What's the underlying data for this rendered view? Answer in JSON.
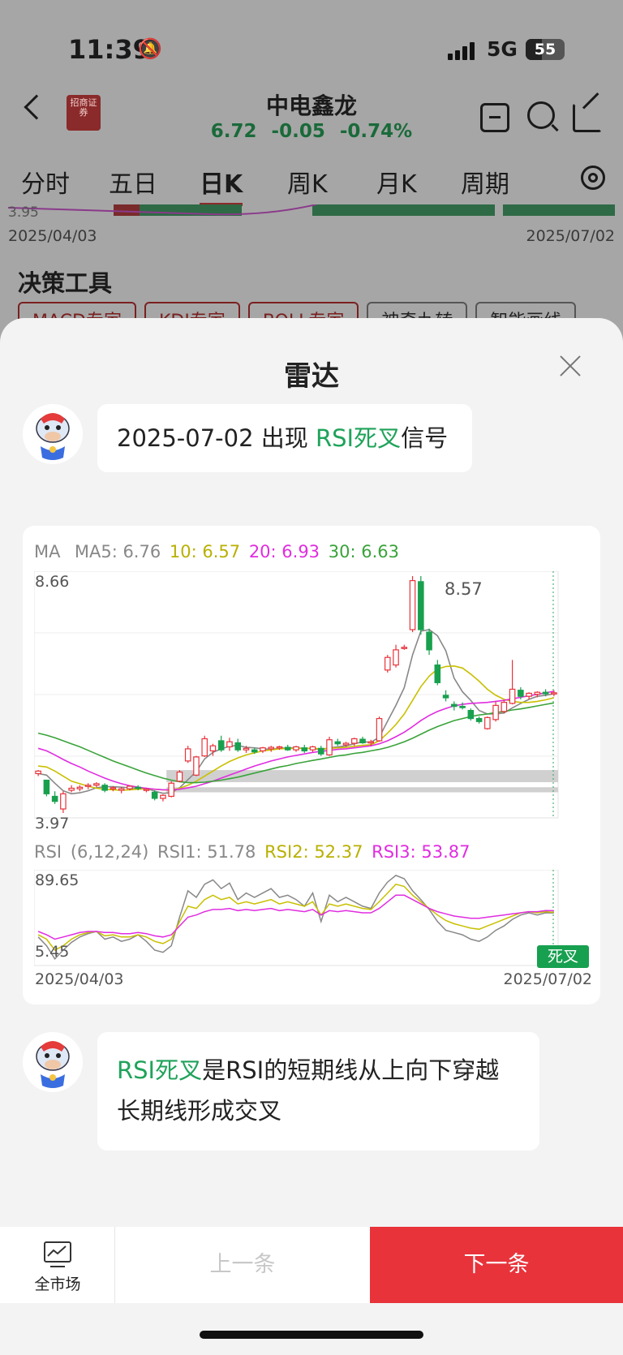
{
  "status_bar": {
    "time": "11:39",
    "network": "5G",
    "battery": "55"
  },
  "header": {
    "broker_logo": "招商证券",
    "stock_name": "中电鑫龙",
    "price": "6.72",
    "change": "-0.05",
    "change_pct": "-0.74%"
  },
  "tabs": [
    "分时",
    "五日",
    "日K",
    "周K",
    "月K",
    "周期"
  ],
  "background_chart": {
    "low_value": "3.95",
    "start_date": "2025/04/03",
    "end_date": "2025/07/02",
    "section_title": "决策工具",
    "tools": [
      "MACD专家",
      "KDJ专家",
      "BOLL专家",
      "神奇九转",
      "智能画线"
    ]
  },
  "sheet": {
    "title": "雷达",
    "message1": {
      "prefix": "2025-07-02 出现 ",
      "highlight": "RSI死叉",
      "suffix": "信号"
    },
    "message2": {
      "highlight": "RSI死叉",
      "text": "是RSI的短期线从上向下穿越长期线形成交叉"
    }
  },
  "chart": {
    "ma_legend": {
      "label": "MA",
      "ma5": "MA5: 6.76",
      "ma10": "10: 6.57",
      "ma20": "20: 6.93",
      "ma30": "30: 6.63"
    },
    "price_high": "8.66",
    "price_low": "3.97",
    "peak_label": "8.57",
    "rsi_legend": {
      "label": "RSI",
      "params": "(6,12,24)",
      "rsi1": "RSI1: 51.78",
      "rsi2": "RSI2: 52.37",
      "rsi3": "RSI3: 53.87"
    },
    "rsi_high": "89.65",
    "rsi_low": "5.45",
    "start_date": "2025/04/03",
    "end_date": "2025/07/02",
    "badge": "死叉"
  },
  "chart_data": {
    "type": "candlestick",
    "ylim": [
      3.97,
      8.66
    ],
    "candles": [
      [
        4.75,
        4.82,
        4.7,
        4.8
      ],
      [
        4.62,
        4.6,
        4.3,
        4.35
      ],
      [
        4.3,
        4.4,
        4.15,
        4.2
      ],
      [
        4.05,
        4.4,
        3.97,
        4.35
      ],
      [
        4.42,
        4.52,
        4.38,
        4.46
      ],
      [
        4.45,
        4.52,
        4.4,
        4.48
      ],
      [
        4.5,
        4.56,
        4.44,
        4.52
      ],
      [
        4.52,
        4.58,
        4.48,
        4.55
      ],
      [
        4.52,
        4.56,
        4.38,
        4.42
      ],
      [
        4.45,
        4.5,
        4.4,
        4.47
      ],
      [
        4.42,
        4.48,
        4.36,
        4.45
      ],
      [
        4.45,
        4.52,
        4.42,
        4.5
      ],
      [
        4.48,
        4.52,
        4.42,
        4.46
      ],
      [
        4.42,
        4.46,
        4.38,
        4.44
      ],
      [
        4.38,
        4.42,
        4.22,
        4.26
      ],
      [
        4.26,
        4.34,
        4.2,
        4.32
      ],
      [
        4.3,
        4.6,
        4.28,
        4.56
      ],
      [
        4.6,
        4.82,
        4.58,
        4.78
      ],
      [
        5.0,
        5.3,
        4.96,
        5.24
      ],
      [
        4.72,
        5.1,
        4.7,
        5.08
      ],
      [
        5.1,
        5.5,
        5.08,
        5.44
      ],
      [
        5.2,
        5.34,
        5.1,
        5.3
      ],
      [
        5.4,
        5.5,
        5.18,
        5.22
      ],
      [
        5.28,
        5.46,
        5.2,
        5.38
      ],
      [
        5.36,
        5.44,
        5.18,
        5.22
      ],
      [
        5.22,
        5.3,
        5.16,
        5.25
      ],
      [
        5.22,
        5.26,
        5.14,
        5.18
      ],
      [
        5.2,
        5.28,
        5.16,
        5.26
      ],
      [
        5.24,
        5.3,
        5.18,
        5.27
      ],
      [
        5.26,
        5.3,
        5.22,
        5.28
      ],
      [
        5.27,
        5.32,
        5.2,
        5.22
      ],
      [
        5.22,
        5.3,
        5.18,
        5.28
      ],
      [
        5.26,
        5.32,
        5.16,
        5.2
      ],
      [
        5.22,
        5.3,
        5.18,
        5.28
      ],
      [
        5.25,
        5.3,
        5.1,
        5.14
      ],
      [
        5.12,
        5.48,
        5.1,
        5.42
      ],
      [
        5.38,
        5.44,
        5.3,
        5.34
      ],
      [
        5.32,
        5.38,
        5.28,
        5.35
      ],
      [
        5.35,
        5.46,
        5.3,
        5.44
      ],
      [
        5.43,
        5.48,
        5.34,
        5.36
      ],
      [
        5.36,
        5.42,
        5.3,
        5.38
      ],
      [
        5.4,
        5.88,
        5.38,
        5.84
      ],
      [
        6.8,
        7.1,
        6.75,
        7.05
      ],
      [
        6.9,
        7.3,
        6.85,
        7.2
      ],
      [
        7.25,
        7.3,
        7.2,
        7.25
      ],
      [
        7.6,
        8.66,
        7.55,
        8.57
      ],
      [
        8.55,
        8.66,
        7.5,
        7.6
      ],
      [
        7.55,
        7.62,
        7.1,
        7.2
      ],
      [
        6.9,
        7.0,
        6.5,
        6.55
      ],
      [
        6.3,
        6.4,
        6.18,
        6.25
      ],
      [
        6.12,
        6.18,
        6.0,
        6.08
      ],
      [
        6.08,
        6.16,
        6.02,
        6.06
      ],
      [
        6.0,
        6.04,
        5.8,
        5.84
      ],
      [
        5.84,
        5.88,
        5.74,
        5.78
      ],
      [
        5.64,
        5.88,
        5.62,
        5.86
      ],
      [
        5.82,
        6.18,
        5.78,
        6.1
      ],
      [
        5.98,
        6.2,
        5.94,
        6.16
      ],
      [
        6.14,
        7.0,
        6.12,
        6.42
      ],
      [
        6.4,
        6.46,
        6.22,
        6.28
      ],
      [
        6.28,
        6.36,
        6.22,
        6.34
      ],
      [
        6.32,
        6.38,
        6.26,
        6.36
      ],
      [
        6.36,
        6.42,
        6.28,
        6.33
      ],
      [
        6.34,
        6.4,
        6.28,
        6.35
      ]
    ],
    "series": [
      {
        "name": "MA5",
        "values": [
          4.75,
          4.72,
          4.56,
          4.41,
          4.35,
          4.37,
          4.41,
          4.47,
          4.49,
          4.49,
          4.48,
          4.47,
          4.46,
          4.46,
          4.4,
          4.36,
          4.37,
          4.47,
          4.63,
          4.79,
          5.04,
          5.17,
          5.24,
          5.29,
          5.31,
          5.27,
          5.26,
          5.24,
          5.23,
          5.25,
          5.26,
          5.26,
          5.25,
          5.25,
          5.22,
          5.26,
          5.28,
          5.3,
          5.34,
          5.38,
          5.37,
          5.47,
          5.79,
          6.1,
          6.45,
          7.1,
          7.57,
          7.6,
          7.48,
          7.18,
          6.64,
          6.37,
          6.2,
          6.0,
          5.93,
          5.93,
          5.95,
          6.05,
          6.14,
          6.22,
          6.28,
          6.3,
          6.33
        ]
      },
      {
        "name": "MA10",
        "values": [
          4.9,
          4.88,
          4.8,
          4.7,
          4.6,
          4.55,
          4.5,
          4.46,
          4.44,
          4.43,
          4.42,
          4.43,
          4.44,
          4.45,
          4.44,
          4.43,
          4.42,
          4.46,
          4.52,
          4.6,
          4.7,
          4.8,
          4.9,
          4.99,
          5.06,
          5.12,
          5.16,
          5.2,
          5.22,
          5.24,
          5.25,
          5.25,
          5.25,
          5.25,
          5.24,
          5.25,
          5.26,
          5.27,
          5.29,
          5.31,
          5.32,
          5.4,
          5.55,
          5.72,
          5.93,
          6.2,
          6.47,
          6.68,
          6.82,
          6.87,
          6.88,
          6.84,
          6.72,
          6.58,
          6.42,
          6.3,
          6.22,
          6.18,
          6.16,
          6.16,
          6.18,
          6.21,
          6.25
        ]
      },
      {
        "name": "MA20",
        "values": [
          5.25,
          5.2,
          5.12,
          5.03,
          4.95,
          4.88,
          4.8,
          4.73,
          4.66,
          4.6,
          4.55,
          4.51,
          4.48,
          4.46,
          4.44,
          4.43,
          4.43,
          4.44,
          4.47,
          4.5,
          4.55,
          4.6,
          4.66,
          4.72,
          4.78,
          4.84,
          4.9,
          4.95,
          5.0,
          5.04,
          5.08,
          5.11,
          5.14,
          5.17,
          5.19,
          5.21,
          5.23,
          5.24,
          5.26,
          5.28,
          5.3,
          5.34,
          5.4,
          5.48,
          5.57,
          5.68,
          5.8,
          5.9,
          5.98,
          6.04,
          6.09,
          6.12,
          6.14,
          6.15,
          6.16,
          6.18,
          6.2,
          6.23,
          6.26,
          6.29,
          6.32,
          6.35,
          6.38
        ]
      },
      {
        "name": "MA30",
        "values": [
          5.55,
          5.51,
          5.46,
          5.4,
          5.34,
          5.28,
          5.21,
          5.14,
          5.07,
          5.0,
          4.94,
          4.88,
          4.82,
          4.76,
          4.71,
          4.66,
          4.62,
          4.59,
          4.57,
          4.57,
          4.58,
          4.6,
          4.62,
          4.65,
          4.68,
          4.72,
          4.76,
          4.8,
          4.84,
          4.88,
          4.91,
          4.95,
          4.98,
          5.01,
          5.04,
          5.07,
          5.1,
          5.12,
          5.15,
          5.17,
          5.2,
          5.23,
          5.27,
          5.32,
          5.38,
          5.45,
          5.53,
          5.61,
          5.68,
          5.74,
          5.8,
          5.84,
          5.88,
          5.91,
          5.93,
          5.96,
          5.98,
          6.01,
          6.03,
          6.06,
          6.09,
          6.12,
          6.15
        ]
      }
    ],
    "rsi": {
      "ylim": [
        5.45,
        89.65
      ],
      "series": [
        {
          "name": "RSI1",
          "values": [
            30,
            22,
            10,
            18,
            25,
            30,
            33,
            35,
            28,
            30,
            26,
            28,
            32,
            26,
            18,
            16,
            22,
            48,
            72,
            66,
            78,
            82,
            74,
            79,
            64,
            70,
            66,
            70,
            74,
            66,
            68,
            64,
            58,
            70,
            44,
            68,
            62,
            66,
            62,
            58,
            56,
            70,
            80,
            86,
            83,
            72,
            64,
            55,
            44,
            36,
            34,
            32,
            28,
            26,
            30,
            36,
            40,
            46,
            50,
            52,
            50,
            52,
            51.78
          ]
        },
        {
          "name": "RSI2",
          "values": [
            32,
            28,
            18,
            22,
            28,
            32,
            34,
            35,
            31,
            32,
            30,
            30,
            32,
            30,
            26,
            24,
            28,
            44,
            58,
            56,
            64,
            68,
            64,
            66,
            60,
            62,
            60,
            62,
            64,
            60,
            62,
            60,
            58,
            62,
            50,
            60,
            58,
            60,
            58,
            56,
            55,
            62,
            70,
            78,
            76,
            68,
            62,
            56,
            50,
            45,
            42,
            40,
            38,
            37,
            40,
            43,
            46,
            49,
            52,
            53,
            52,
            53,
            52.37
          ]
        },
        {
          "name": "RSI3",
          "values": [
            35,
            32,
            28,
            30,
            32,
            34,
            35,
            35,
            34,
            34,
            33,
            33,
            34,
            33,
            31,
            30,
            32,
            40,
            48,
            50,
            53,
            55,
            55,
            56,
            54,
            55,
            54,
            55,
            56,
            54,
            55,
            54,
            53,
            55,
            50,
            54,
            53,
            54,
            53,
            52,
            52,
            56,
            62,
            68,
            68,
            64,
            60,
            56,
            53,
            51,
            49,
            48,
            47,
            47,
            48,
            49,
            50,
            51,
            52,
            53,
            53,
            54,
            53.87
          ]
        }
      ]
    },
    "x_range": [
      "2025/04/03",
      "2025/07/02"
    ]
  },
  "bottom_bar": {
    "market": "全市场",
    "prev": "上一条",
    "next": "下一条"
  }
}
